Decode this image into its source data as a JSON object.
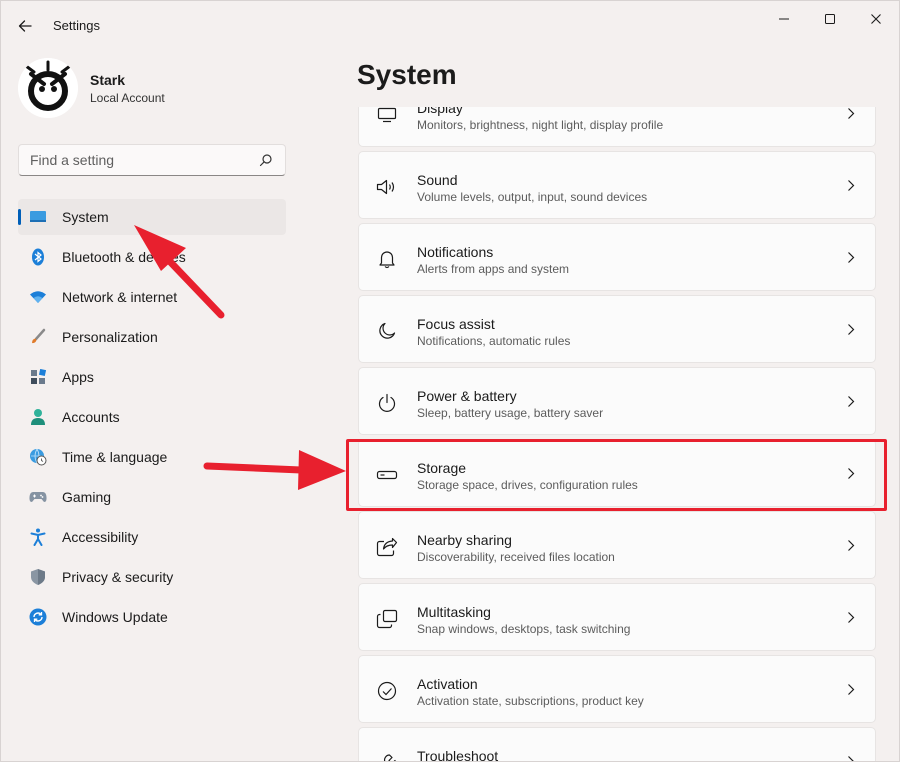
{
  "window": {
    "title": "Settings",
    "controls": {
      "minimize": "minimize-icon",
      "maximize": "maximize-icon",
      "close": "close-icon"
    }
  },
  "account": {
    "name": "Stark",
    "type": "Local Account"
  },
  "search": {
    "placeholder": "Find a setting"
  },
  "nav": {
    "items": [
      {
        "label": "System",
        "icon": "system-icon",
        "selected": true
      },
      {
        "label": "Bluetooth & devices",
        "icon": "bluetooth-icon"
      },
      {
        "label": "Network & internet",
        "icon": "wifi-icon"
      },
      {
        "label": "Personalization",
        "icon": "brush-icon"
      },
      {
        "label": "Apps",
        "icon": "apps-icon"
      },
      {
        "label": "Accounts",
        "icon": "person-icon"
      },
      {
        "label": "Time & language",
        "icon": "globe-clock-icon"
      },
      {
        "label": "Gaming",
        "icon": "gamepad-icon"
      },
      {
        "label": "Accessibility",
        "icon": "accessibility-icon"
      },
      {
        "label": "Privacy & security",
        "icon": "shield-icon"
      },
      {
        "label": "Windows Update",
        "icon": "update-icon"
      }
    ]
  },
  "main": {
    "title": "System",
    "cards": [
      {
        "title": "Display",
        "desc": "Monitors, brightness, night light, display profile",
        "icon": "monitor-icon"
      },
      {
        "title": "Sound",
        "desc": "Volume levels, output, input, sound devices",
        "icon": "speaker-icon"
      },
      {
        "title": "Notifications",
        "desc": "Alerts from apps and system",
        "icon": "bell-icon"
      },
      {
        "title": "Focus assist",
        "desc": "Notifications, automatic rules",
        "icon": "moon-icon"
      },
      {
        "title": "Power & battery",
        "desc": "Sleep, battery usage, battery saver",
        "icon": "power-icon"
      },
      {
        "title": "Storage",
        "desc": "Storage space, drives, configuration rules",
        "icon": "drive-icon",
        "highlighted": true
      },
      {
        "title": "Nearby sharing",
        "desc": "Discoverability, received files location",
        "icon": "share-icon"
      },
      {
        "title": "Multitasking",
        "desc": "Snap windows, desktops, task switching",
        "icon": "multitask-icon"
      },
      {
        "title": "Activation",
        "desc": "Activation state, subscriptions, product key",
        "icon": "check-circle-icon"
      },
      {
        "title": "Troubleshoot",
        "desc": "",
        "icon": "wrench-icon"
      }
    ]
  },
  "colors": {
    "accent": "#005fb8",
    "annotation": "#e8202e"
  }
}
